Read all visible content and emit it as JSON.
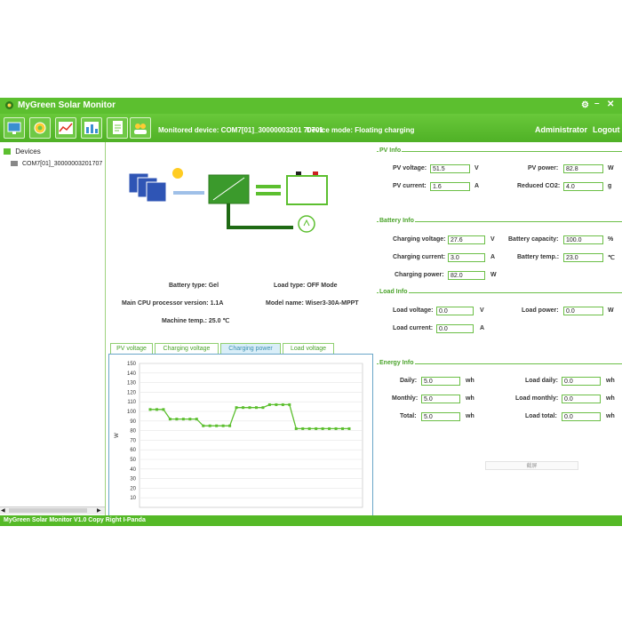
{
  "app": {
    "title": "MyGreen Solar Monitor",
    "monitored_device": "Monitored device: COM7[01]_30000003201 70701",
    "device_mode": "Device mode: Floating charging",
    "user": "Administrator",
    "logout": "Logout",
    "status_bar": "MyGreen Solar Monitor V1.0   Copy Right I-Panda"
  },
  "sidebar": {
    "root": "Devices",
    "items": [
      {
        "label": "COM7[01]_30000003201707"
      }
    ]
  },
  "system": {
    "battery_type": "Battery type: Gel",
    "load_type": "Load type: OFF Mode",
    "cpu_version": "Main CPU processor version: 1.1A",
    "model_name": "Model name:   Wiser3-30A-MPPT",
    "machine_temp": "Machine temp.: 25.0  ℃"
  },
  "tabs": [
    {
      "label": "PV voltage"
    },
    {
      "label": "Charging voltage"
    },
    {
      "label": "Charging power"
    },
    {
      "label": "Load voltage"
    }
  ],
  "chart_data": {
    "type": "line",
    "ylabel": "W",
    "ylim": [
      0,
      150
    ],
    "yticks": [
      10,
      20,
      30,
      40,
      50,
      60,
      70,
      80,
      90,
      100,
      110,
      120,
      130,
      140,
      150
    ],
    "series": [
      {
        "color": "#5cbf2f",
        "values": [
          102,
          102,
          102,
          92,
          92,
          92,
          92,
          92,
          85,
          85,
          85,
          85,
          85,
          104,
          104,
          104,
          104,
          104,
          107,
          107,
          107,
          107,
          82,
          82,
          82,
          82,
          82,
          82,
          82,
          82,
          82
        ]
      }
    ]
  },
  "pv_info": {
    "title": "PV Info",
    "pv_voltage_label": "PV voltage:",
    "pv_voltage": "51.5",
    "pv_voltage_unit": "V",
    "pv_power_label": "PV power:",
    "pv_power": "82.8",
    "pv_power_unit": "W",
    "pv_current_label": "PV current:",
    "pv_current": "1.6",
    "pv_current_unit": "A",
    "co2_label": "Reduced CO2:",
    "co2": "4.0",
    "co2_unit": "g"
  },
  "battery_info": {
    "title": "Battery Info",
    "cv_label": "Charging voltage:",
    "cv": "27.6",
    "cv_unit": "V",
    "cap_label": "Battery capacity:",
    "cap": "100.0",
    "cap_unit": "%",
    "cc_label": "Charging current:",
    "cc": "3.0",
    "cc_unit": "A",
    "temp_label": "Battery temp.:",
    "temp": "23.0",
    "temp_unit": "℃",
    "cp_label": "Charging power:",
    "cp": "82.0",
    "cp_unit": "W"
  },
  "load_info": {
    "title": "Load Info",
    "lv_label": "Load voltage:",
    "lv": "0.0",
    "lv_unit": "V",
    "lp_label": "Load power:",
    "lp": "0.0",
    "lp_unit": "W",
    "lc_label": "Load current:",
    "lc": "0.0",
    "lc_unit": "A"
  },
  "energy_info": {
    "title": "Energy Info",
    "daily_label": "Daily:",
    "daily": "5.0",
    "daily_unit": "wh",
    "load_daily_label": "Load daily:",
    "load_daily": "0.0",
    "load_daily_unit": "wh",
    "monthly_label": "Monthly:",
    "monthly": "5.0",
    "monthly_unit": "wh",
    "load_monthly_label": "Load monthly:",
    "load_monthly": "0.0",
    "load_monthly_unit": "wh",
    "total_label": "Total:",
    "total": "5.0",
    "total_unit": "wh",
    "load_total_label": "Load total:",
    "load_total": "0.0",
    "load_total_unit": "wh",
    "screenshot_button": "截屏"
  }
}
